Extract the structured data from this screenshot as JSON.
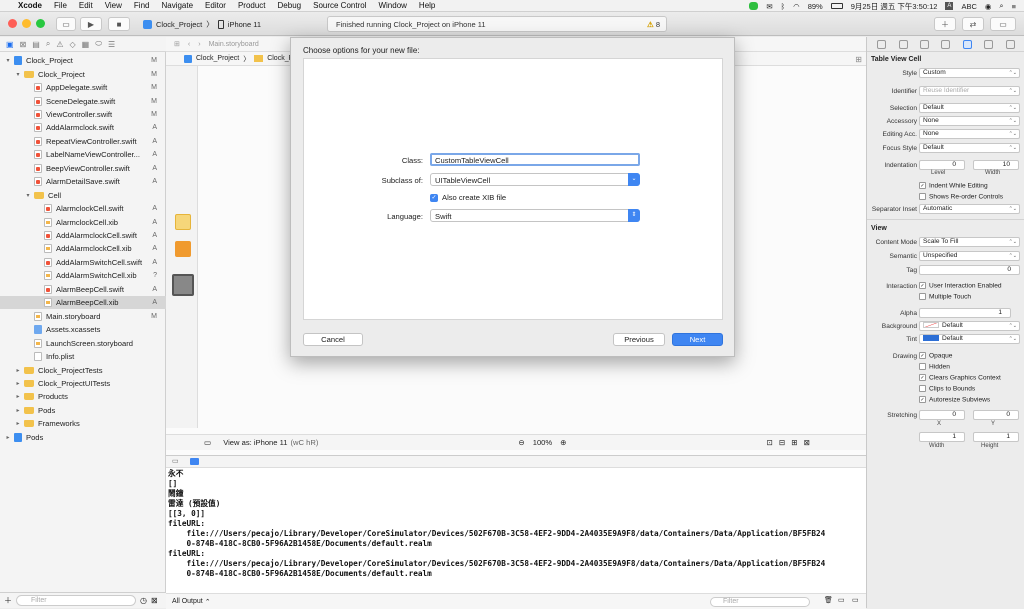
{
  "menubar": {
    "app": "Xcode",
    "items": [
      "File",
      "Edit",
      "View",
      "Find",
      "Navigate",
      "Editor",
      "Product",
      "Debug",
      "Source Control",
      "Window",
      "Help"
    ],
    "battery": "89%",
    "clock": "9月25日 週五 下午3:50:12",
    "input": "ABC"
  },
  "toolbar": {
    "scheme_project": "Clock_Project",
    "scheme_device": "iPhone 11",
    "status_text": "Finished running Clock_Project on iPhone 11",
    "warnings": "8"
  },
  "navigator": {
    "rows": [
      {
        "label": "Clock_Project",
        "badge": "M",
        "indent": 0,
        "icon": "proj",
        "disc": "▾"
      },
      {
        "label": "Clock_Project",
        "badge": "M",
        "indent": 1,
        "icon": "folder",
        "disc": "▾"
      },
      {
        "label": "AppDelegate.swift",
        "badge": "M",
        "indent": 2,
        "icon": "swift"
      },
      {
        "label": "SceneDelegate.swift",
        "badge": "M",
        "indent": 2,
        "icon": "swift"
      },
      {
        "label": "ViewController.swift",
        "badge": "M",
        "indent": 2,
        "icon": "swift"
      },
      {
        "label": "AddAlarmclock.swift",
        "badge": "A",
        "indent": 2,
        "icon": "swift"
      },
      {
        "label": "RepeatViewController.swift",
        "badge": "A",
        "indent": 2,
        "icon": "swift"
      },
      {
        "label": "LabelNameViewController...",
        "badge": "A",
        "indent": 2,
        "icon": "swift"
      },
      {
        "label": "BeepViewController.swift",
        "badge": "A",
        "indent": 2,
        "icon": "swift"
      },
      {
        "label": "AlarmDetailSave.swift",
        "badge": "A",
        "indent": 2,
        "icon": "swift"
      },
      {
        "label": "Cell",
        "badge": "",
        "indent": 2,
        "icon": "folder",
        "disc": "▾"
      },
      {
        "label": "AlarmclockCell.swift",
        "badge": "A",
        "indent": 3,
        "icon": "swift"
      },
      {
        "label": "AlarmclockCell.xib",
        "badge": "A",
        "indent": 3,
        "icon": "xib"
      },
      {
        "label": "AddAlarmclockCell.swift",
        "badge": "A",
        "indent": 3,
        "icon": "swift"
      },
      {
        "label": "AddAlarmclockCell.xib",
        "badge": "A",
        "indent": 3,
        "icon": "xib"
      },
      {
        "label": "AddAlarmSwitchCell.swift",
        "badge": "A",
        "indent": 3,
        "icon": "swift"
      },
      {
        "label": "AddAlarmSwitchCell.xib",
        "badge": "?",
        "indent": 3,
        "icon": "xib"
      },
      {
        "label": "AlarmBeepCell.swift",
        "badge": "A",
        "indent": 3,
        "icon": "swift"
      },
      {
        "label": "AlarmBeepCell.xib",
        "badge": "A",
        "indent": 3,
        "icon": "xib",
        "selected": true
      },
      {
        "label": "Main.storyboard",
        "badge": "M",
        "indent": 2,
        "icon": "xib"
      },
      {
        "label": "Assets.xcassets",
        "badge": "",
        "indent": 2,
        "icon": "assets"
      },
      {
        "label": "LaunchScreen.storyboard",
        "badge": "",
        "indent": 2,
        "icon": "xib"
      },
      {
        "label": "Info.plist",
        "badge": "",
        "indent": 2,
        "icon": "plist"
      },
      {
        "label": "Clock_ProjectTests",
        "badge": "",
        "indent": 1,
        "icon": "folder",
        "disc": "▸"
      },
      {
        "label": "Clock_ProjectUITests",
        "badge": "",
        "indent": 1,
        "icon": "folder",
        "disc": "▸"
      },
      {
        "label": "Products",
        "badge": "",
        "indent": 1,
        "icon": "folder",
        "disc": "▸"
      },
      {
        "label": "Pods",
        "badge": "",
        "indent": 1,
        "icon": "folder",
        "disc": "▸"
      },
      {
        "label": "Frameworks",
        "badge": "",
        "indent": 1,
        "icon": "folder",
        "disc": "▸"
      },
      {
        "label": "Pods",
        "badge": "",
        "indent": 0,
        "icon": "proj",
        "disc": "▸"
      }
    ],
    "filter_placeholder": "Filter"
  },
  "editor": {
    "tab": "Main.storyboard",
    "crumb1": "Clock_Project",
    "crumb2": "Clock_Project",
    "view_as": "View as: iPhone 11",
    "view_as_traits": "(wC hR)",
    "zoom": "100%"
  },
  "dialog": {
    "title": "Choose options for your new file:",
    "class_label": "Class:",
    "class_value": "CustomTableViewCell",
    "subclass_label": "Subclass of:",
    "subclass_value": "UITableViewCell",
    "xib_label": "Also create XIB file",
    "language_label": "Language:",
    "language_value": "Swift",
    "cancel": "Cancel",
    "previous": "Previous",
    "next": "Next"
  },
  "console": {
    "lines": [
      "永不",
      "[]",
      "鬧鐘",
      "雷達 (預設值)",
      "[[3, 0]]",
      "fileURL:",
      "    file:///Users/pecajo/Library/Developer/CoreSimulator/Devices/502F670B-3C58-4EF2-9DD4-2A4035E9A9F8/data/Containers/Data/Application/BF5FB24",
      "    0-874B-418C-8CB0-5F96A2B1458E/Documents/default.realm",
      "fileURL:",
      "    file:///Users/pecajo/Library/Developer/CoreSimulator/Devices/502F670B-3C58-4EF2-9DD4-2A4035E9A9F8/data/Containers/Data/Application/BF5FB24",
      "    0-874B-418C-8CB0-5F96A2B1458E/Documents/default.realm"
    ],
    "output_selector": "All Output",
    "filter_placeholder": "Filter"
  },
  "inspector": {
    "section1": "Table View Cell",
    "style_label": "Style",
    "style_value": "Custom",
    "identifier_label": "Identifier",
    "identifier_placeholder": "Reuse Identifier",
    "selection_label": "Selection",
    "selection_value": "Default",
    "accessory_label": "Accessory",
    "accessory_value": "None",
    "editing_label": "Editing Acc.",
    "editing_value": "None",
    "focus_label": "Focus Style",
    "focus_value": "Default",
    "indentation_label": "Indentation",
    "indent_level": "0",
    "indent_width": "10",
    "level_label": "Level",
    "width_label": "Width",
    "indent_while_editing": "Indent While Editing",
    "show_reorder": "Shows Re-order Controls",
    "separator_label": "Separator Inset",
    "separator_value": "Automatic",
    "section2": "View",
    "content_mode_label": "Content Mode",
    "content_mode_value": "Scale To Fill",
    "semantic_label": "Semantic",
    "semantic_value": "Unspecified",
    "tag_label": "Tag",
    "tag_value": "0",
    "interaction_label": "Interaction",
    "user_interaction": "User Interaction Enabled",
    "multiple_touch": "Multiple Touch",
    "alpha_label": "Alpha",
    "alpha_value": "1",
    "background_label": "Background",
    "background_value": "Default",
    "tint_label": "Tint",
    "tint_value": "Default",
    "drawing_label": "Drawing",
    "opaque": "Opaque",
    "hidden": "Hidden",
    "clears": "Clears Graphics Context",
    "clips": "Clips to Bounds",
    "autoresize": "Autoresize Subviews",
    "stretching_label": "Stretching",
    "stretch_x": "0",
    "stretch_y": "0",
    "stretch_w": "1",
    "stretch_h": "1",
    "x_label": "X",
    "y_label": "Y",
    "w_label": "Width",
    "h_label": "Height",
    "tint_color": "#2d6fd6"
  }
}
